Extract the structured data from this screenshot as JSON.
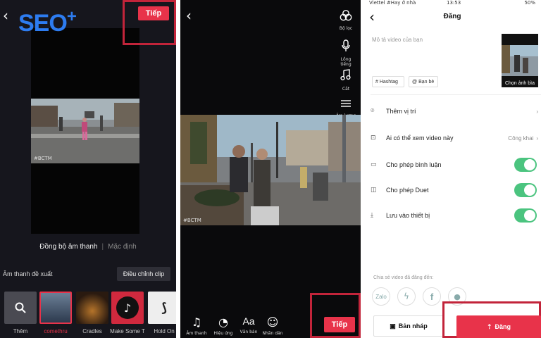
{
  "brand": {
    "logo_text": "SEO",
    "logo_plus": "+"
  },
  "screen1": {
    "back": "‹",
    "next_label": "Tiếp",
    "watermark": "#BCTM",
    "tab_sync": "Đồng bộ âm thanh",
    "tab_sep": "|",
    "tab_default": "Mặc định",
    "recommended_label": "Âm thanh đề xuất",
    "adjust_label": "Điều chỉnh clip",
    "tracks": [
      "Thêm",
      "comethru",
      "Cradles",
      "Make Some T",
      "Hold On"
    ]
  },
  "screen2": {
    "back": "‹",
    "watermark": "#BCTM",
    "tools": [
      "Bộ lọc",
      "Lồng tiếng",
      "Cắt",
      "Âm lượng"
    ],
    "bottom_tools": [
      "Âm thanh",
      "Hiệu ứng",
      "Văn bản",
      "Nhãn dán"
    ],
    "next_label": "Tiếp"
  },
  "screen3": {
    "status_left": "Viettel #Hay ở nhà",
    "status_time": "13:53",
    "status_right": "50%",
    "back": "‹",
    "title": "Đăng",
    "description_placeholder": "Mô tả video của bạn",
    "cover_label": "Chọn ảnh bìa",
    "chip_hashtag": "Hashtag",
    "chip_friends": "Bạn bè",
    "location": "Thêm vị trí",
    "who_can_view": "Ai có thể xem video này",
    "who_can_view_value": "Công khai",
    "allow_comments": "Cho phép bình luận",
    "allow_duet": "Cho phép Duet",
    "save_to_device": "Lưu vào thiết bị",
    "share_label": "Chia sẻ video đã đăng đến:",
    "share_zalo": "Zalo",
    "draft_label": "Bản nháp",
    "post_label": "Đăng"
  },
  "colors": {
    "accent": "#e8334a",
    "toggle_on": "#4bc47f",
    "logo_blue": "#2d7cf0",
    "highlight": "#c2243a"
  }
}
